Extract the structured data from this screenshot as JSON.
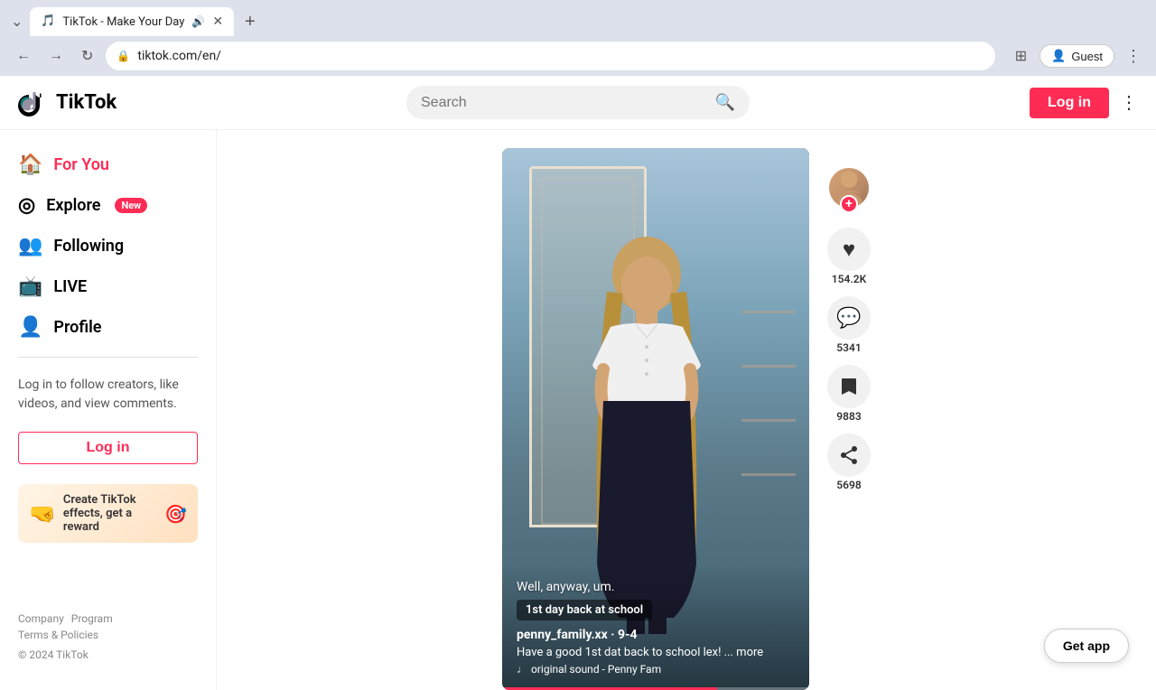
{
  "browser": {
    "tab_title": "TikTok - Make Your Day",
    "tab_favicon": "🎵",
    "url": "tiktok.com/en/",
    "new_tab_label": "+",
    "nav": {
      "back": "←",
      "forward": "→",
      "refresh": "↻"
    },
    "guest_label": "Guest",
    "more_icon": "⋮"
  },
  "header": {
    "logo_text": "TikTok",
    "search_placeholder": "Search",
    "login_label": "Log in",
    "more_icon": "⋮"
  },
  "sidebar": {
    "nav_items": [
      {
        "id": "for-you",
        "label": "For You",
        "icon": "🏠",
        "active": true
      },
      {
        "id": "explore",
        "label": "Explore",
        "icon": "◎",
        "badge": "New",
        "active": false
      },
      {
        "id": "following",
        "label": "Following",
        "icon": "👥",
        "active": false
      },
      {
        "id": "live",
        "label": "LIVE",
        "icon": "📺",
        "active": false
      },
      {
        "id": "profile",
        "label": "Profile",
        "icon": "👤",
        "active": false
      }
    ],
    "login_prompt": "Log in to follow creators, like videos, and view comments.",
    "login_btn_label": "Log in",
    "promo_text": "Create TikTok effects, get a reward",
    "footer_links": [
      "Company",
      "Program",
      "Terms & Policies"
    ],
    "copyright": "© 2024 TikTok"
  },
  "video": {
    "caption": "Well, anyway, um.",
    "tag": "1st day back at school",
    "username": "penny_family.xx · 9-4",
    "description": "Have a good 1st dat back to school lex! ...  more",
    "sound": "♩  original sound - Penny Fam",
    "likes": "154.2K",
    "comments": "5341",
    "bookmarks": "9883",
    "shares": "5698"
  },
  "action_sidebar": {
    "like_icon": "♥",
    "comment_icon": "💬",
    "bookmark_icon": "🔖",
    "share_icon": "↗",
    "follow_plus": "+"
  },
  "get_app_btn": "Get app"
}
